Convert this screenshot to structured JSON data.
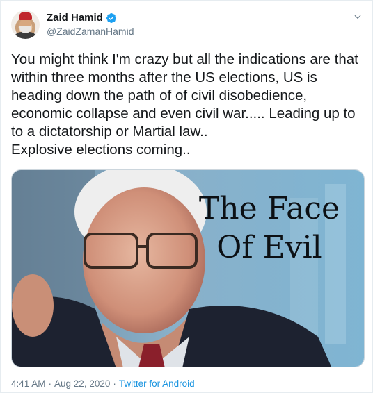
{
  "author": {
    "display_name": "Zaid Hamid",
    "handle": "@ZaidZamanHamid",
    "verified": true
  },
  "tweet": {
    "lines": [
      "You might think I'm crazy but all the indications are that",
      "within three months after the US elections, US is",
      "heading down the path of of civil disobedience,",
      "economic collapse and even civil war..... Leading up to",
      "to a dictatorship or Martial law..",
      "Explosive elections coming.."
    ]
  },
  "media": {
    "title_line1": "The Face",
    "title_line2": "Of Evil"
  },
  "meta": {
    "time": "4:41 AM",
    "separator1": "·",
    "date": "Aug 22, 2020",
    "separator2": "·",
    "source": "Twitter for Android"
  },
  "colors": {
    "verified_blue": "#1da1f2",
    "link_blue": "#1b95e0",
    "secondary_gray": "#657786"
  },
  "icons": {
    "verified": "verified-badge-icon",
    "caret": "chevron-down-icon"
  }
}
